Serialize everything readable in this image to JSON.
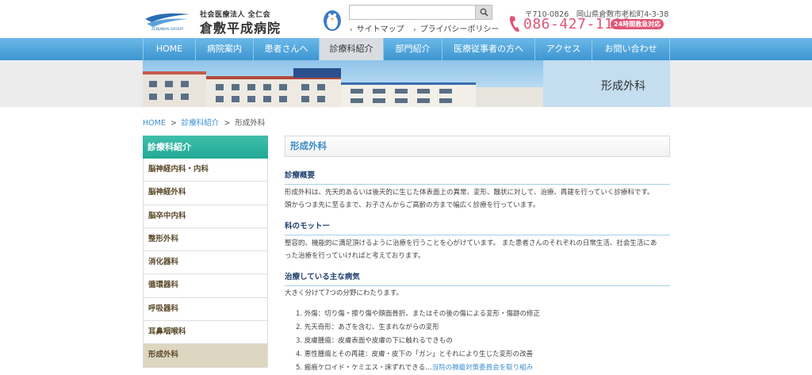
{
  "header": {
    "logo_sub": "社会医療法人 全仁会",
    "logo_name": "倉敷平成病院",
    "logo_mark_text": "ZENJINKAI GROUP",
    "search": {
      "placeholder": "",
      "value": ""
    },
    "links": [
      {
        "label": "サイトマップ"
      },
      {
        "label": "プライバシーポリシー"
      }
    ],
    "address": "〒710-0826　岡山県倉敷市老松町4-3-38",
    "phone": "086-427-1111",
    "badge": "24時間救急対応"
  },
  "nav": {
    "items": [
      {
        "label": "HOME"
      },
      {
        "label": "病院案内"
      },
      {
        "label": "患者さんへ"
      },
      {
        "label": "診療科紹介"
      },
      {
        "label": "部門紹介"
      },
      {
        "label": "医療従事者の方へ"
      },
      {
        "label": "アクセス"
      },
      {
        "label": "お問い合わせ"
      }
    ],
    "active_index": 3
  },
  "banner": {
    "title": "形成外科"
  },
  "breadcrumb": {
    "home": "HOME",
    "parent": "診療科紹介",
    "current": "形成外科",
    "separator": ">"
  },
  "sidebar": {
    "title": "診療科紹介",
    "items": [
      {
        "label": "脳神経内科・内科"
      },
      {
        "label": "脳神経外科"
      },
      {
        "label": "脳卒中内科"
      },
      {
        "label": "整形外科"
      },
      {
        "label": "消化器科"
      },
      {
        "label": "循環器科"
      },
      {
        "label": "呼吸器科"
      },
      {
        "label": "耳鼻咽喉科"
      },
      {
        "label": "形成外科"
      }
    ],
    "active_index": 8
  },
  "main": {
    "title": "形成外科",
    "sections": [
      {
        "heading": "診療概要",
        "lines": [
          "形成外科は、先天的あるいは後天的に生じた体表面上の異常、変形、醜状に対して、治療、再建を行っていく診療科です。",
          "頭からつま先に至るまで、お子さんからご高齢の方まで幅広く診療を行っています。"
        ]
      },
      {
        "heading": "科のモットー",
        "lines": [
          "整容的、機能的に満足頂けるように治療を行うことを心がけています。 また患者さんのそれぞれの日常生活、社会生活にあ",
          "った治療を行っていければと考えております。"
        ]
      },
      {
        "heading": "治療している主な病気",
        "lines": [
          "大きく分けて7つの分野にわたります。"
        ]
      }
    ],
    "list": [
      "1. 外傷：切り傷・擦り傷や顔面骨折、またはその後の傷による変形・傷跡の修正",
      "2. 先天奇形：あざを含む、生まれながらの変形",
      "3. 皮膚腫瘍：皮膚表面や皮膚の下に触れるできもの",
      "4. 悪性腫瘍とその再建：皮膚・皮下の「ガン」とそれにより生じた変形の改善"
    ],
    "list_partial": {
      "prefix": "5. 瘢痕ケロイド・ケミエス・床ずれできる…",
      "link": "当院の褥瘡対策委員会を取り組み"
    }
  },
  "colors": {
    "nav_top": "#6bb9e8",
    "nav_bottom": "#3d95d1",
    "sidebar_head": "#22a995",
    "phone": "#e05577",
    "heading_text": "#1e3f6e",
    "title_text": "#3a8ac8",
    "active_side": "#ddd6c0"
  },
  "icons": {
    "search": "search-icon",
    "phone": "phone-icon",
    "arrow": "chevron-right-icon"
  }
}
